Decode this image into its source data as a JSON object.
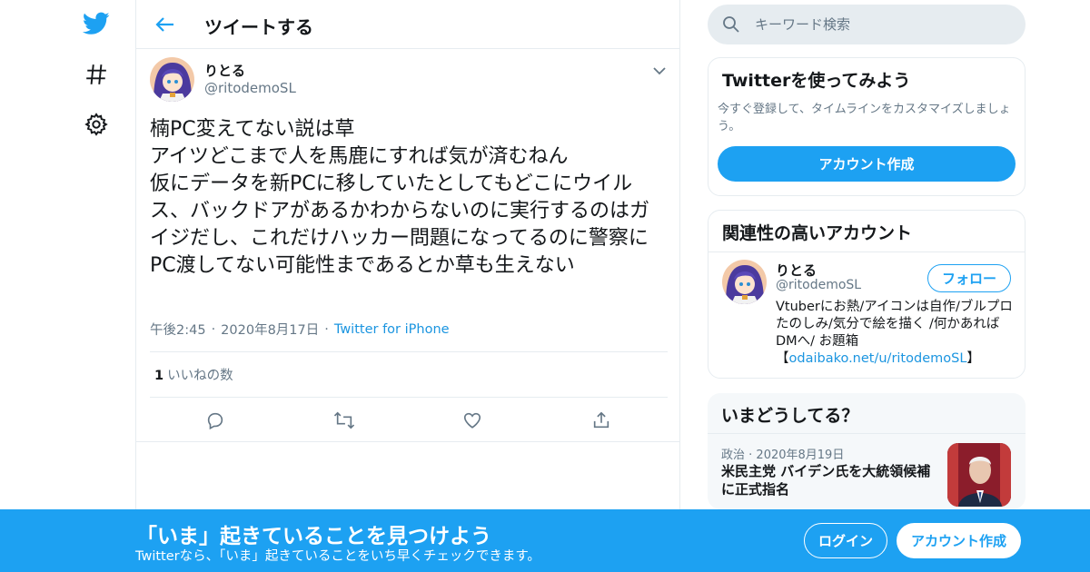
{
  "app": {
    "accent": "#1da1f2",
    "icons": {
      "logo": "twitter-bird-icon",
      "explore": "hashtag-icon",
      "settings": "gear-icon"
    }
  },
  "header": {
    "title": "ツイートする"
  },
  "tweet": {
    "author_name": "りとる",
    "author_handle": "@ritodemoSL",
    "text": "楠PC変えてない説は草\nアイツどこまで人を馬鹿にすれば気が済むねん\n仮にデータを新PCに移していたとしてもどこにウイルス、バックドアがあるかわからないのに実行するのはガイジだし、これだけハッカー問題になってるのに警察にPC渡してない可能性まであるとか草も生えない",
    "time": "午後2:45",
    "date": "2020年8月17日",
    "source": "Twitter for iPhone",
    "like_count": "1",
    "like_label": "いいねの数"
  },
  "search": {
    "placeholder": "キーワード検索"
  },
  "signup_card": {
    "title": "Twitterを使ってみよう",
    "subtitle": "今すぐ登録して、タイムラインをカスタマイズしましょう。",
    "button": "アカウント作成"
  },
  "related": {
    "title": "関連性の高いアカウント",
    "name": "りとる",
    "handle": "@ritodemoSL",
    "follow": "フォロー",
    "bio": "Vtuberにお熱/アイコンは自作/ブルプロたのしみ/気分で絵を描く /何かあればDMへ/ お題箱",
    "bio_link_open": "【",
    "bio_link": "odaibako.net/u/ritodemoSL",
    "bio_link_close": "】"
  },
  "trends": {
    "title": "いまどうしてる？",
    "category": "政治",
    "date": "2020年8月19日",
    "headline": "米民主党 バイデン氏を大統領候補に正式指名"
  },
  "bottom_bar": {
    "title": "「いま」起きていることを見つけよう",
    "subtitle": "Twitterなら、「いま」起きていることをいち早くチェックできます。",
    "login": "ログイン",
    "signup": "アカウント作成"
  }
}
